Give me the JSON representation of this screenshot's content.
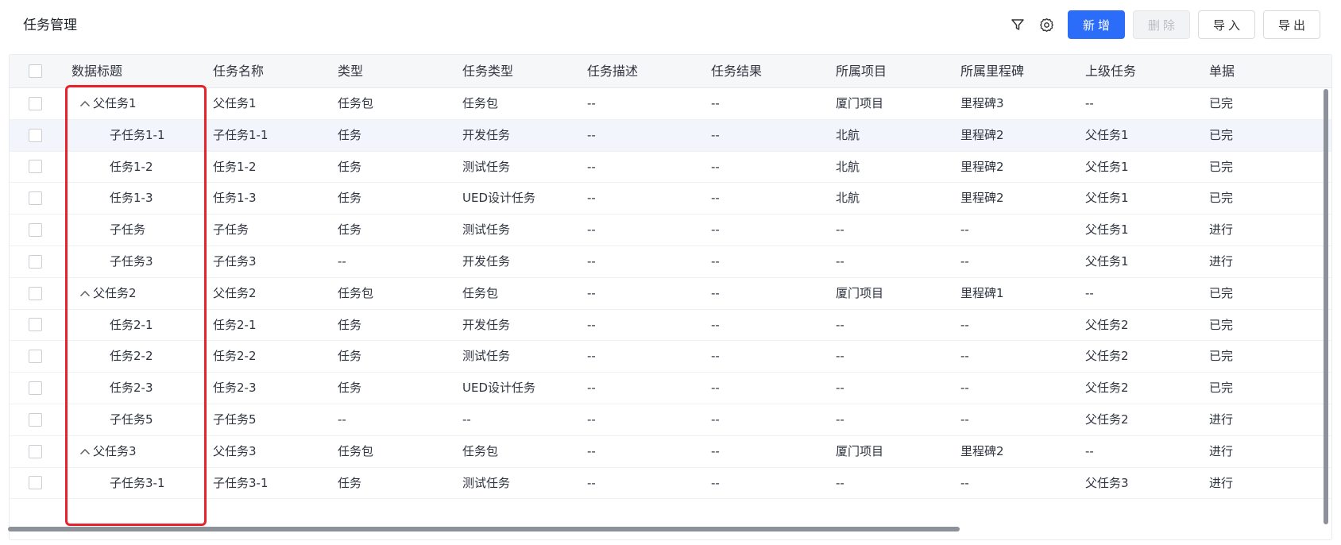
{
  "header": {
    "title": "任务管理",
    "filter_icon": "filter-icon",
    "settings_icon": "gear-icon",
    "buttons": {
      "add": "新增",
      "delete": "删除",
      "import": "导入",
      "export": "导出"
    }
  },
  "table": {
    "columns": [
      "数据标题",
      "任务名称",
      "类型",
      "任务类型",
      "任务描述",
      "任务结果",
      "所属项目",
      "所属里程碑",
      "上级任务",
      "单据"
    ],
    "rows": [
      {
        "title": "父任务1",
        "level": 0,
        "expanded": true,
        "name": "父任务1",
        "type": "任务包",
        "task_type": "任务包",
        "desc": "--",
        "result": "--",
        "project": "厦门项目",
        "milestone": "里程碑3",
        "parent": "--",
        "status": "已完"
      },
      {
        "title": "子任务1-1",
        "level": 1,
        "name": "子任务1-1",
        "type": "任务",
        "task_type": "开发任务",
        "desc": "--",
        "result": "--",
        "project": "北航",
        "milestone": "里程碑2",
        "parent": "父任务1",
        "status": "已完"
      },
      {
        "title": "任务1-2",
        "level": 1,
        "name": "任务1-2",
        "type": "任务",
        "task_type": "测试任务",
        "desc": "--",
        "result": "--",
        "project": "北航",
        "milestone": "里程碑2",
        "parent": "父任务1",
        "status": "已完"
      },
      {
        "title": "任务1-3",
        "level": 1,
        "name": "任务1-3",
        "type": "任务",
        "task_type": "UED设计任务",
        "desc": "--",
        "result": "--",
        "project": "北航",
        "milestone": "里程碑2",
        "parent": "父任务1",
        "status": "已完"
      },
      {
        "title": "子任务",
        "level": 1,
        "name": "子任务",
        "type": "任务",
        "task_type": "测试任务",
        "desc": "--",
        "result": "--",
        "project": "--",
        "milestone": "--",
        "parent": "父任务1",
        "status": "进行"
      },
      {
        "title": "子任务3",
        "level": 1,
        "name": "子任务3",
        "type": "--",
        "task_type": "开发任务",
        "desc": "--",
        "result": "--",
        "project": "--",
        "milestone": "--",
        "parent": "父任务1",
        "status": "进行"
      },
      {
        "title": "父任务2",
        "level": 0,
        "expanded": true,
        "name": "父任务2",
        "type": "任务包",
        "task_type": "任务包",
        "desc": "--",
        "result": "--",
        "project": "厦门项目",
        "milestone": "里程碑1",
        "parent": "--",
        "status": "已完"
      },
      {
        "title": "任务2-1",
        "level": 1,
        "name": "任务2-1",
        "type": "任务",
        "task_type": "开发任务",
        "desc": "--",
        "result": "--",
        "project": "--",
        "milestone": "--",
        "parent": "父任务2",
        "status": "已完"
      },
      {
        "title": "任务2-2",
        "level": 1,
        "name": "任务2-2",
        "type": "任务",
        "task_type": "测试任务",
        "desc": "--",
        "result": "--",
        "project": "--",
        "milestone": "--",
        "parent": "父任务2",
        "status": "已完"
      },
      {
        "title": "任务2-3",
        "level": 1,
        "name": "任务2-3",
        "type": "任务",
        "task_type": "UED设计任务",
        "desc": "--",
        "result": "--",
        "project": "--",
        "milestone": "--",
        "parent": "父任务2",
        "status": "已完"
      },
      {
        "title": "子任务5",
        "level": 1,
        "name": "子任务5",
        "type": "--",
        "task_type": "--",
        "desc": "--",
        "result": "--",
        "project": "--",
        "milestone": "--",
        "parent": "父任务2",
        "status": "进行"
      },
      {
        "title": "父任务3",
        "level": 0,
        "expanded": true,
        "name": "父任务3",
        "type": "任务包",
        "task_type": "任务包",
        "desc": "--",
        "result": "--",
        "project": "厦门项目",
        "milestone": "里程碑2",
        "parent": "--",
        "status": "进行"
      },
      {
        "title": "子任务3-1",
        "level": 1,
        "name": "子任务3-1",
        "type": "任务",
        "task_type": "测试任务",
        "desc": "--",
        "result": "--",
        "project": "--",
        "milestone": "--",
        "parent": "父任务3",
        "status": "进行"
      }
    ],
    "highlighted_row": 1
  },
  "colors": {
    "primary": "#2b6df8",
    "annotation_box": "#e8222a"
  }
}
